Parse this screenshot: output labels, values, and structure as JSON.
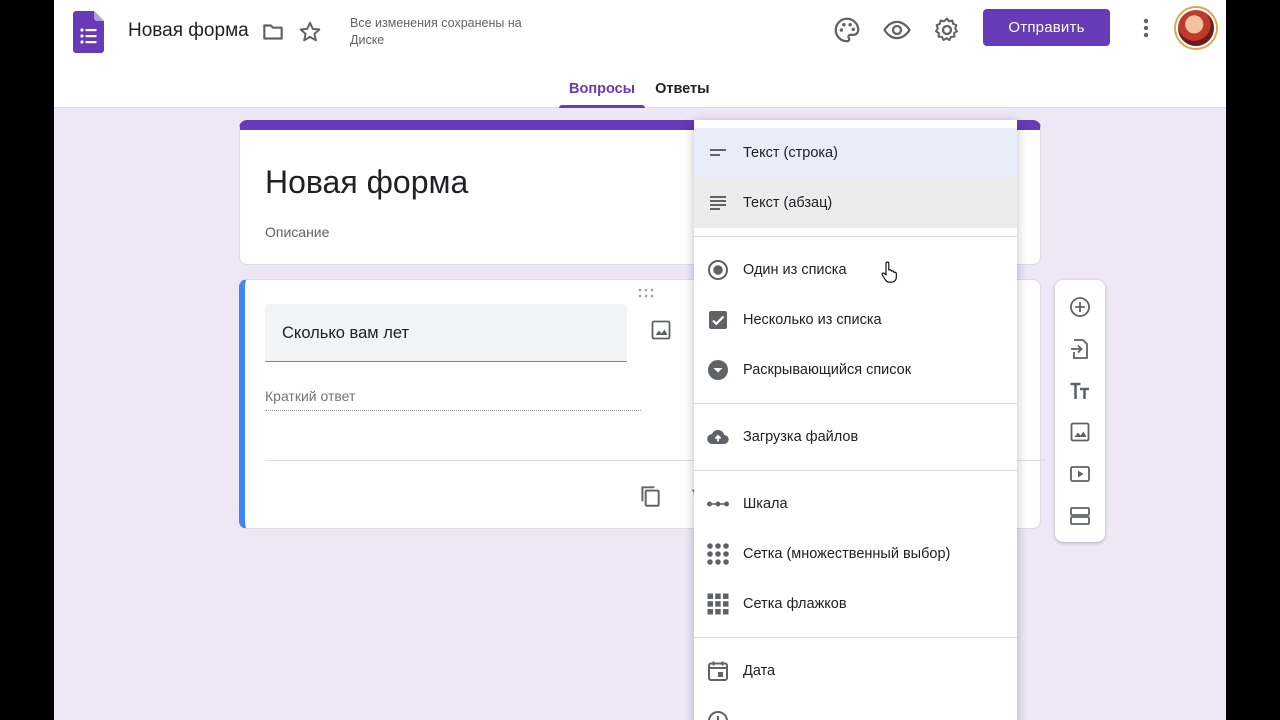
{
  "header": {
    "title": "Новая форма",
    "save_status": "Все изменения сохранены на Диске",
    "send_label": "Отправить",
    "tabs": [
      {
        "label": "Вопросы",
        "active": true
      },
      {
        "label": "Ответы",
        "active": false
      }
    ]
  },
  "title_card": {
    "title": "Новая форма",
    "description": "Описание"
  },
  "question": {
    "title": "Сколько вам лет",
    "answer_placeholder": "Краткий ответ"
  },
  "type_menu": {
    "items": [
      {
        "label": "Текст (строка)",
        "icon": "short-text-icon"
      },
      {
        "label": "Текст (абзац)",
        "icon": "paragraph-icon"
      },
      {
        "label": "Один из списка",
        "icon": "radio-icon"
      },
      {
        "label": "Несколько из списка",
        "icon": "checkbox-icon"
      },
      {
        "label": "Раскрывающийся список",
        "icon": "dropdown-icon"
      },
      {
        "label": "Загрузка файлов",
        "icon": "cloud-upload-icon"
      },
      {
        "label": "Шкала",
        "icon": "linear-scale-icon"
      },
      {
        "label": "Сетка (множественный выбор)",
        "icon": "grid-dots-icon"
      },
      {
        "label": "Сетка флажков",
        "icon": "grid-squares-icon"
      },
      {
        "label": "Дата",
        "icon": "calendar-icon"
      }
    ]
  },
  "colors": {
    "brand": "#673ab7",
    "question_accent": "#4285f4",
    "background": "#ede7f6"
  }
}
